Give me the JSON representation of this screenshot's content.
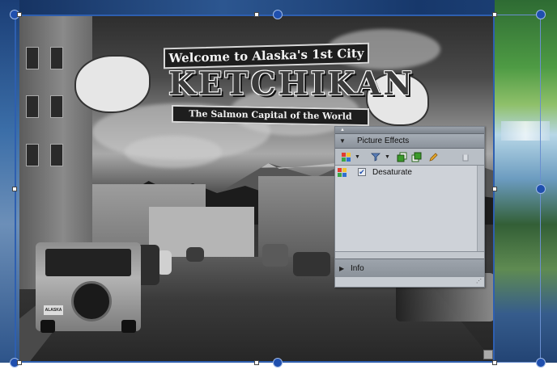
{
  "photo": {
    "sign": {
      "top_banner": "Welcome to Alaska's 1st City",
      "title": "KETCHIKAN",
      "bottom_banner": "The Salmon Capital of the World"
    },
    "license_plate": "ALASKA"
  },
  "panel": {
    "header_label": "Picture Effects",
    "toolbar": {
      "effects_icon": "effects-grid-icon",
      "filter_icon": "funnel-icon",
      "layer_icons": [
        "layer-forward-icon",
        "layer-backward-icon"
      ],
      "edit_icon": "pencil-icon",
      "delete_icon": "trash-icon"
    },
    "effects": [
      {
        "name": "Desaturate",
        "checked": true
      }
    ],
    "info_label": "Info"
  },
  "colors": {
    "selection": "#2e5fb0",
    "panel_bg": "#c7ccd2",
    "edit_pencil": "#e5a72a",
    "layer_icon": "#3a9a2a"
  }
}
